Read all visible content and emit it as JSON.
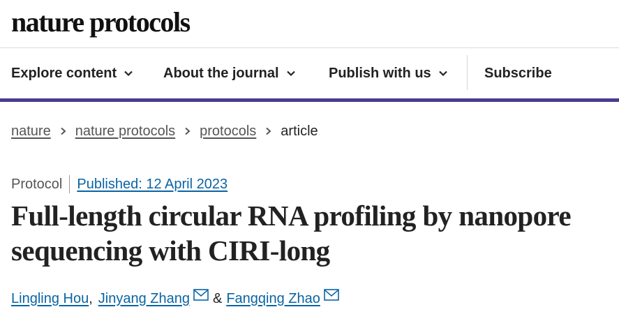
{
  "header": {
    "logo": "nature protocols"
  },
  "nav": {
    "items": [
      {
        "label": "Explore content"
      },
      {
        "label": "About the journal"
      },
      {
        "label": "Publish with us"
      }
    ],
    "subscribe": "Subscribe"
  },
  "breadcrumb": [
    "nature",
    "nature protocols",
    "protocols",
    "article"
  ],
  "article": {
    "type": "Protocol",
    "published": "Published: 12 April 2023",
    "title_line1": "Full-length circular RNA profiling by nanopore",
    "title_line2": "sequencing with CIRI-long",
    "authors": [
      "Lingling Hou",
      "Jinyang Zhang",
      "Fangqing Zhao"
    ],
    "comma": ",",
    "ampersand": "&"
  },
  "colors": {
    "accent": "#4b3b8f",
    "link": "#0a64a4"
  }
}
